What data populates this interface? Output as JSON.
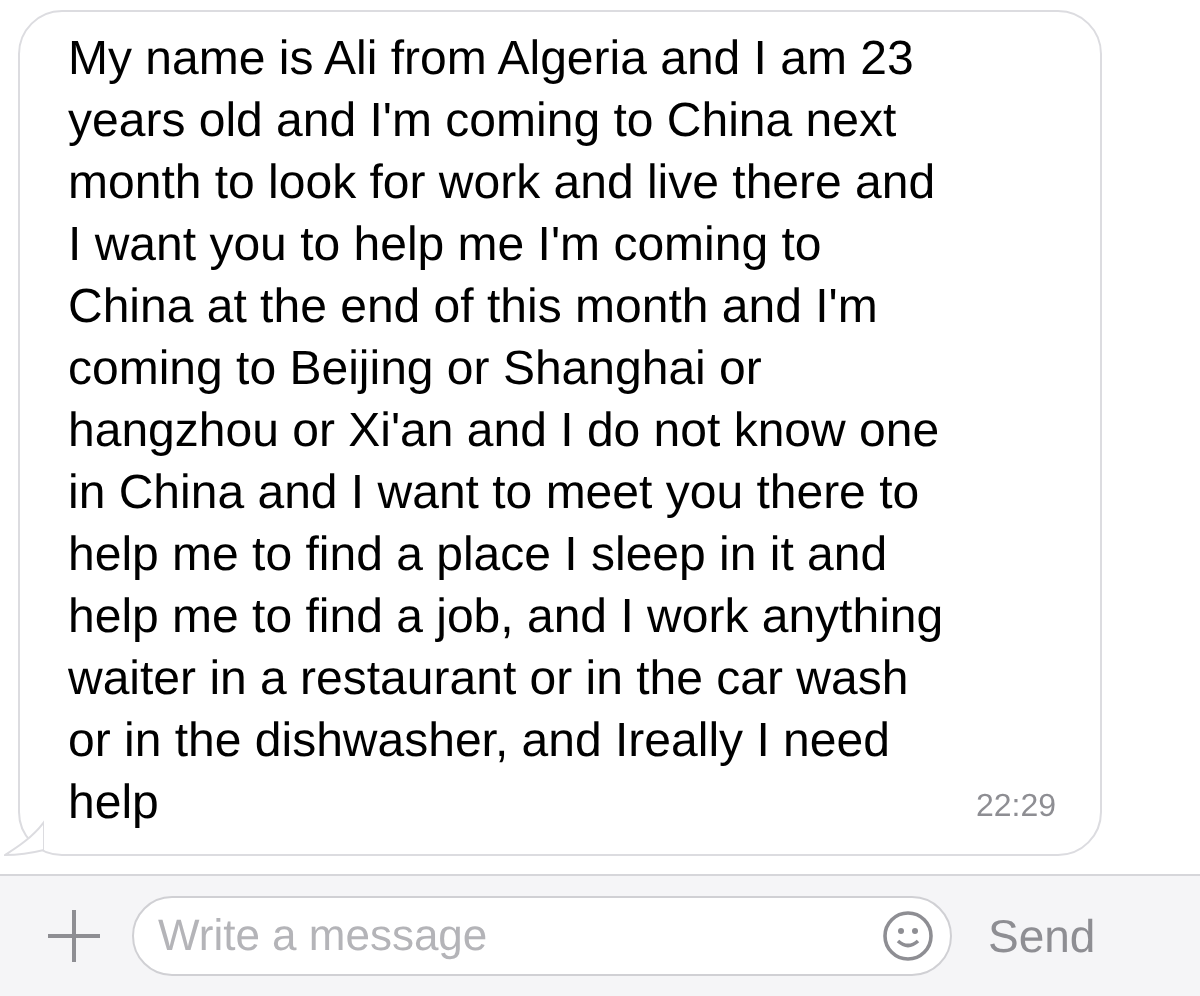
{
  "messages": [
    {
      "text": "My name is Ali from Algeria and I am 23 years old and I'm coming to China next month to look for work and live there and I want you to help me I'm coming to China at the end of this month and I'm coming to Beijing or Shanghai or hangzhou or Xi'an and I do not know one in China and I want to meet you there to help me to find a place I sleep in it and help me to find a job, and I work anything waiter in a restaurant or in the car wash or in the dishwasher, and Ireally I need help",
      "time": "22:29"
    }
  ],
  "composer": {
    "placeholder": "Write a message",
    "send": "Send"
  }
}
